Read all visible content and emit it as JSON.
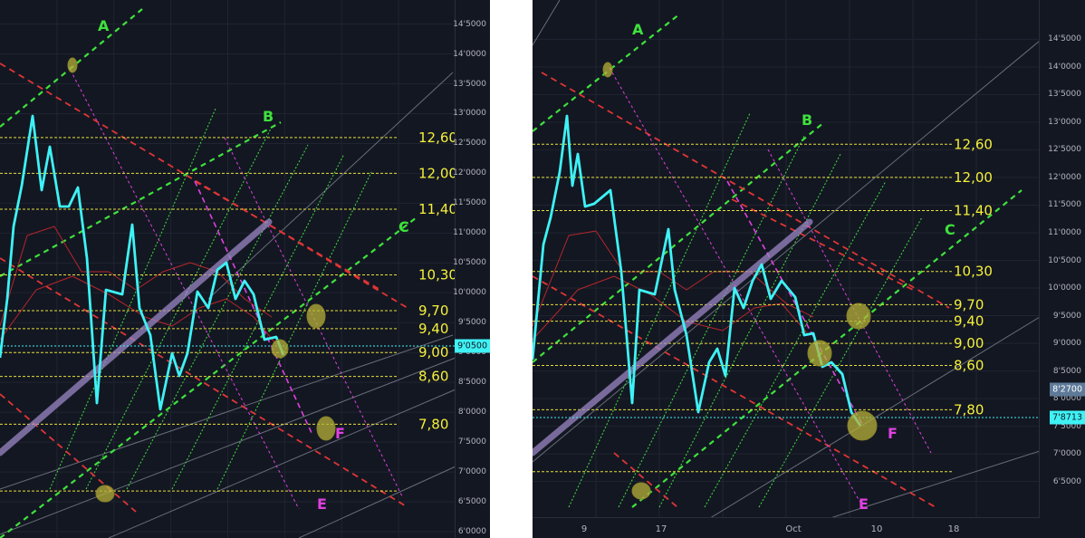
{
  "chart_data": [
    {
      "type": "line",
      "panel": "left",
      "ylim": [
        6.0,
        14.6
      ],
      "y_ticks": [
        "14'5000",
        "14'0000",
        "13'5000",
        "13'0000",
        "12'5000",
        "12'0000",
        "11'5000",
        "11'0000",
        "10'5000",
        "10'0000",
        "9'5000",
        "9'0000",
        "8'5000",
        "8'0000",
        "7'5000",
        "7'0000",
        "6'5000",
        "6'0000"
      ],
      "current_price_label": "9'0500",
      "current_price": 9.05,
      "levels": [
        "12,60",
        "12,00",
        "11,40",
        "10,30",
        "9,70",
        "9,40",
        "9,00",
        "8,60",
        "7,80"
      ],
      "level_values": [
        12.6,
        12.0,
        11.4,
        10.3,
        9.7,
        9.4,
        9.0,
        8.6,
        7.8
      ],
      "channel_labels": [
        "A",
        "B",
        "C",
        "E",
        "F"
      ],
      "grid": true
    },
    {
      "type": "line",
      "panel": "right",
      "ylim": [
        6.2,
        14.8
      ],
      "y_ticks": [
        "14'5000",
        "14'0000",
        "13'5000",
        "13'0000",
        "12'5000",
        "12'0000",
        "11'5000",
        "11'0000",
        "10'5000",
        "10'0000",
        "9'5000",
        "9'0000",
        "8'5000",
        "8'0000",
        "7'5000",
        "7'0000",
        "6'5000"
      ],
      "price_tag_upper": "8'2700",
      "price_tag_lower": "7'8713",
      "price_upper": 8.27,
      "price_lower": 7.8713,
      "x_ticks": [
        "9",
        "17",
        "Oct",
        "10",
        "18"
      ],
      "levels": [
        "12,60",
        "12,00",
        "11,40",
        "10,30",
        "9,70",
        "9,40",
        "9,00",
        "8,60",
        "7,80"
      ],
      "level_values": [
        12.6,
        12.0,
        11.4,
        10.3,
        9.7,
        9.4,
        9.0,
        8.6,
        7.8
      ],
      "channel_labels": [
        "A",
        "B",
        "C",
        "E",
        "F"
      ],
      "grid": true
    }
  ],
  "colors": {
    "background": "#131722",
    "price_line": "#3ef2f5",
    "level_line": "#e6e039",
    "level_text": "#f5f03a",
    "green_channel": "#3fe23c",
    "red_channel": "#e03535",
    "magenta_channel": "#e040e0",
    "trend_band": "#9b87c4",
    "marker": "#b7b23a",
    "label_green": "#3fe23c",
    "label_magenta": "#e040e0"
  }
}
